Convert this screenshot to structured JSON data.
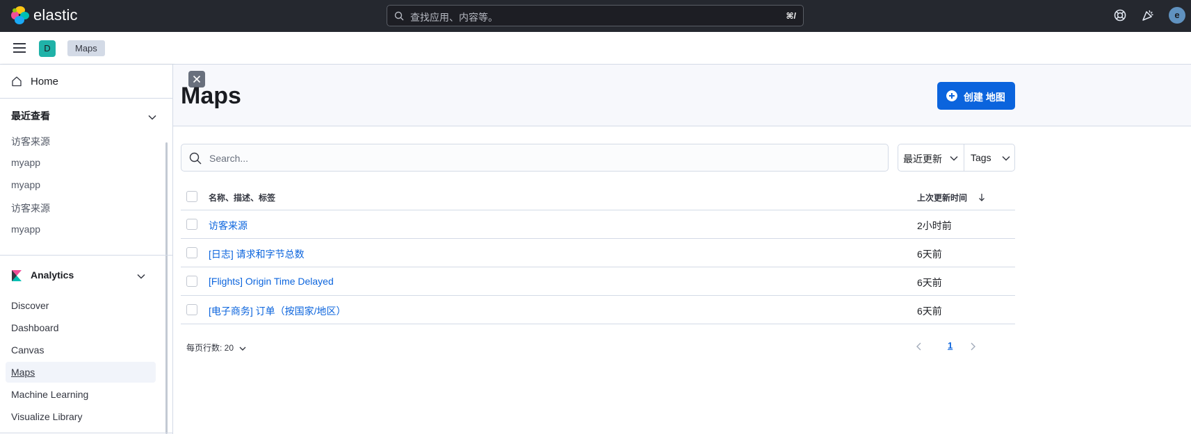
{
  "header": {
    "brand": "elastic",
    "search_placeholder": "查找应用、内容等。",
    "search_shortcut": "⌘/",
    "user_initial": "e"
  },
  "subbar": {
    "space_initial": "D",
    "breadcrumb": "Maps"
  },
  "sidebar": {
    "home": "Home",
    "recent_title": "最近查看",
    "recent_items": [
      "访客来源",
      "myapp",
      "myapp",
      "访客来源",
      "myapp"
    ],
    "analytics_title": "Analytics",
    "analytics_items": [
      "Discover",
      "Dashboard",
      "Canvas",
      "Maps",
      "Machine Learning",
      "Visualize Library"
    ],
    "active_item": "Maps"
  },
  "page": {
    "title": "Maps",
    "create_button": "创建 地图",
    "search_placeholder": "Search...",
    "sort_filter": "最近更新",
    "tags_filter": "Tags"
  },
  "table": {
    "col_name": "名称、描述、标签",
    "col_updated": "上次更新时间",
    "rows": [
      {
        "name": "访客来源",
        "updated": "2小时前"
      },
      {
        "name": "[日志] 请求和字节总数",
        "updated": "6天前"
      },
      {
        "name": "[Flights] Origin Time Delayed",
        "updated": "6天前"
      },
      {
        "name": "[电子商务] 订单（按国家/地区）",
        "updated": "6天前"
      }
    ]
  },
  "pagination": {
    "rows_per_page": "每页行数: 20",
    "current_page": "1"
  },
  "colors": {
    "header_bg": "#25282f",
    "primary": "#0b64dd",
    "space_badge": "#20b2a8",
    "avatar": "#6092c0"
  }
}
